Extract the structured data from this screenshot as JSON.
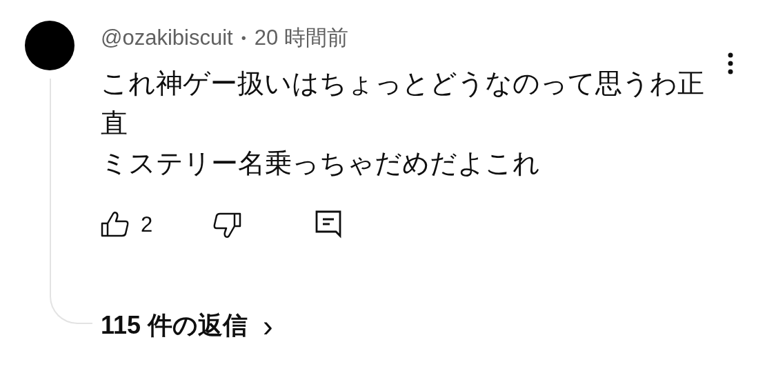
{
  "comment": {
    "author": "@ozakibiscuit",
    "separator": "•",
    "time": "20 時間前",
    "lines": [
      "これ神ゲー扱いはちょっとどうなのって思うわ正直",
      "ミステリー名乗っちゃだめだよこれ"
    ],
    "like_count": "2",
    "liked": false,
    "disliked": false
  },
  "replies": {
    "label": "115 件の返信",
    "arrow": "›"
  }
}
